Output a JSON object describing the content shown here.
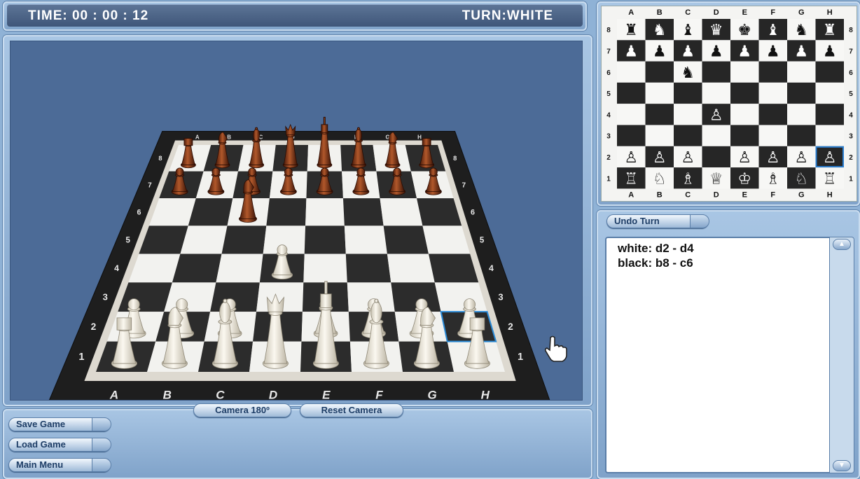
{
  "status": {
    "timer": "TIME: 00 : 00 : 12",
    "turn": "TURN:WHITE"
  },
  "board": {
    "files": [
      "A",
      "B",
      "C",
      "D",
      "E",
      "F",
      "G",
      "H"
    ],
    "ranks": [
      "8",
      "7",
      "6",
      "5",
      "4",
      "3",
      "2",
      "1"
    ],
    "position": [
      [
        "r",
        "n",
        "b",
        "q",
        "k",
        "b",
        "n",
        "r"
      ],
      [
        "p",
        "p",
        "p",
        "p",
        "p",
        "p",
        "p",
        "p"
      ],
      [
        "",
        "",
        "n",
        "",
        "",
        "",
        "",
        ""
      ],
      [
        "",
        "",
        "",
        "",
        "",
        "",
        "",
        ""
      ],
      [
        "",
        "",
        "",
        "P",
        "",
        "",
        "",
        ""
      ],
      [
        "",
        "",
        "",
        "",
        "",
        "",
        "",
        ""
      ],
      [
        "P",
        "P",
        "P",
        "",
        "P",
        "P",
        "P",
        "P"
      ],
      [
        "R",
        "N",
        "B",
        "Q",
        "K",
        "B",
        "N",
        "R"
      ]
    ],
    "highlight": "h2",
    "colors": {
      "light": "#f2f2ef",
      "dark": "#2c2c2c",
      "frame": "#1d1d1d",
      "wood": "#8a3c1d",
      "ivory": "#f3efe4"
    }
  },
  "minimap_glyphs": {
    "K": "♔",
    "Q": "♕",
    "R": "♖",
    "B": "♗",
    "N": "♘",
    "P": "♙",
    "k": "♚",
    "q": "♛",
    "r": "♜",
    "b": "♝",
    "n": "♞",
    "p": "♟"
  },
  "camera": {
    "rotate_label": "Camera 180º",
    "reset_label": "Reset Camera"
  },
  "menu": {
    "save_label": "Save Game",
    "load_label": "Load Game",
    "main_label": "Main Menu"
  },
  "log": {
    "undo_label": "Undo Turn",
    "moves": [
      "white: d2 - d4",
      "black: b8 - c6"
    ]
  },
  "icons": {
    "cursor": "hand-pointer-icon",
    "scroll_up": "scroll-up-icon",
    "scroll_down": "scroll-down-icon"
  }
}
